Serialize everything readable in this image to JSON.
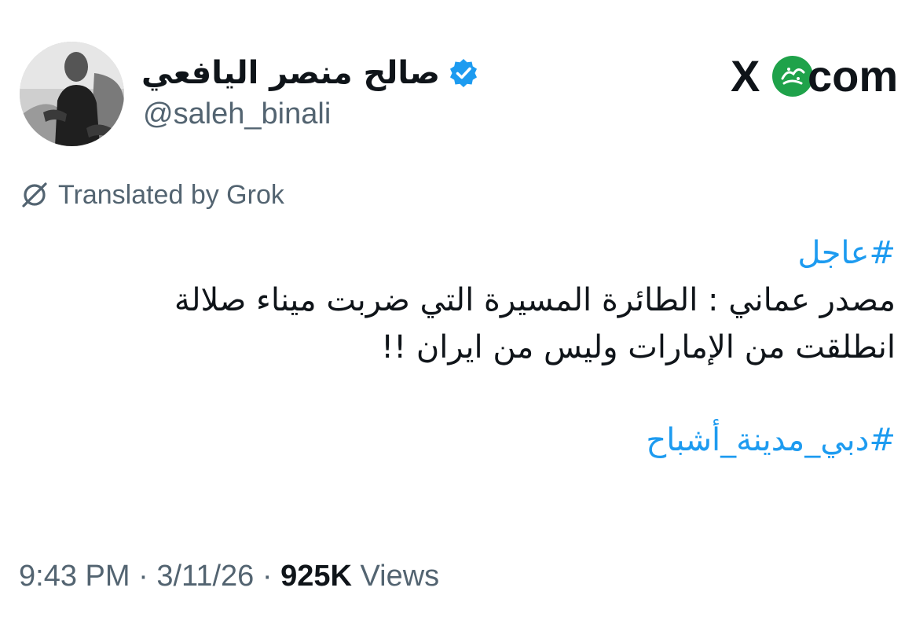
{
  "author": {
    "display_name": "صالح منصر اليافعي",
    "handle": "@saleh_binali",
    "verified": true
  },
  "site_mark": {
    "x_label": "X",
    "com_label": "com",
    "badge_color": "#1fa24a"
  },
  "translation": {
    "label": "Translated by Grok",
    "icon": "grok-icon"
  },
  "tweet": {
    "hashtag_1": "#عاجل",
    "line_1": "مصدر عماني : الطائرة المسيرة التي ضربت ميناء صلالة",
    "line_2": "انطلقت من الإمارات وليس من ايران  !!",
    "hashtag_2": "#دبي_مدينة_أشباح"
  },
  "meta": {
    "time": "9:43 PM",
    "separator_1": " · ",
    "date": "3/11/26",
    "separator_2": " · ",
    "views_count": "925K",
    "views_label": " Views"
  },
  "colors": {
    "link": "#1d9bf0",
    "secondary_text": "#536471",
    "primary_text": "#0f1419",
    "verified_badge": "#1d9bf0"
  }
}
